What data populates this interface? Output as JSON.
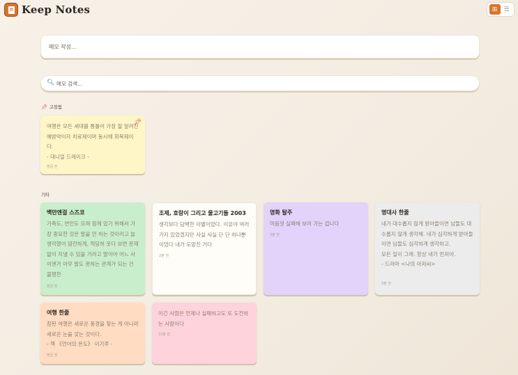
{
  "app": {
    "title": "Keep Notes"
  },
  "view_toggle": {
    "grid_icon": "grid-icon",
    "list_icon": "list-icon",
    "active": "grid"
  },
  "memo_input": {
    "placeholder": "메모 작성..."
  },
  "search": {
    "placeholder": "메모 검색..."
  },
  "sections": {
    "pinned_label": "고정됨",
    "others_label": "기타"
  },
  "colors": {
    "accent": "#d9742b",
    "yellow": "#fff6c7",
    "green": "#c9eecc",
    "white": "#fffdf8",
    "purple": "#e3d2f9",
    "gray": "#ececec",
    "peach": "#ffdcc2",
    "pink": "#ffd3db"
  },
  "pinned_notes": [
    {
      "title": "",
      "content": "여행은 모든 세대를 통틀어 가장 잘 알려진 예방약이자 치료제이며 동시에 회복제이다.\n- 대니얼 드레이크 -",
      "time": "방금 전",
      "color": "yellow",
      "pinned": true
    }
  ],
  "other_notes": [
    {
      "title": "백만엔걸 스즈코",
      "content": "가족도, 연인도 오래 함께 있기 위해서 가장 중요한 것은 말을 안 하는 것이라고 늘 생각했어 얌전하게, 적당히 웃다 보면 문제없이 지낼 수 있을 거라고 말이야 어느 사이엔가 아무 말도 못하는 관계가 되는 건 불행한",
      "time": "방금 전",
      "color": "green"
    },
    {
      "title": "조제, 호랑이 그리고 물고기들 2003",
      "content": "생각보다 담백한 이별이었다. 이유야 여러 가지 있었겠지만 사실 사실 단 단 하나뿐이었다 내가 도망친 거다",
      "time": "2분 전",
      "color": "white"
    },
    {
      "title": "영화 탈주",
      "content": "마음껏 실패해 보러 가는 겁니다",
      "time": "3분 전",
      "color": "purple"
    },
    {
      "title": "명대사 한줄",
      "content": "네가 대수롭지 않게 받아들이면 남들도 대수롭지 않게 생각해. 네가 심각하게 받아들이면 남들도 심각하게 생각하고.\n모든 일이 그래. 항상 네가 먼저야.\n- 드라마 <나의 아저씨>",
      "time": "5분 전",
      "color": "gray"
    },
    {
      "title": "여행 한줄",
      "content": "참된 여행은 새로운 풍경을 찾는 게 아니라 새로운 눈을 갖는 것이다.\n- 책 《언어의 온도》 이기주 -",
      "time": "방금 전",
      "color": "peach"
    },
    {
      "title": "",
      "content": "이긴 사람은 언제나 실패하고도 또 도전하는 사람이다",
      "time": "22분 전",
      "color": "pink"
    }
  ]
}
